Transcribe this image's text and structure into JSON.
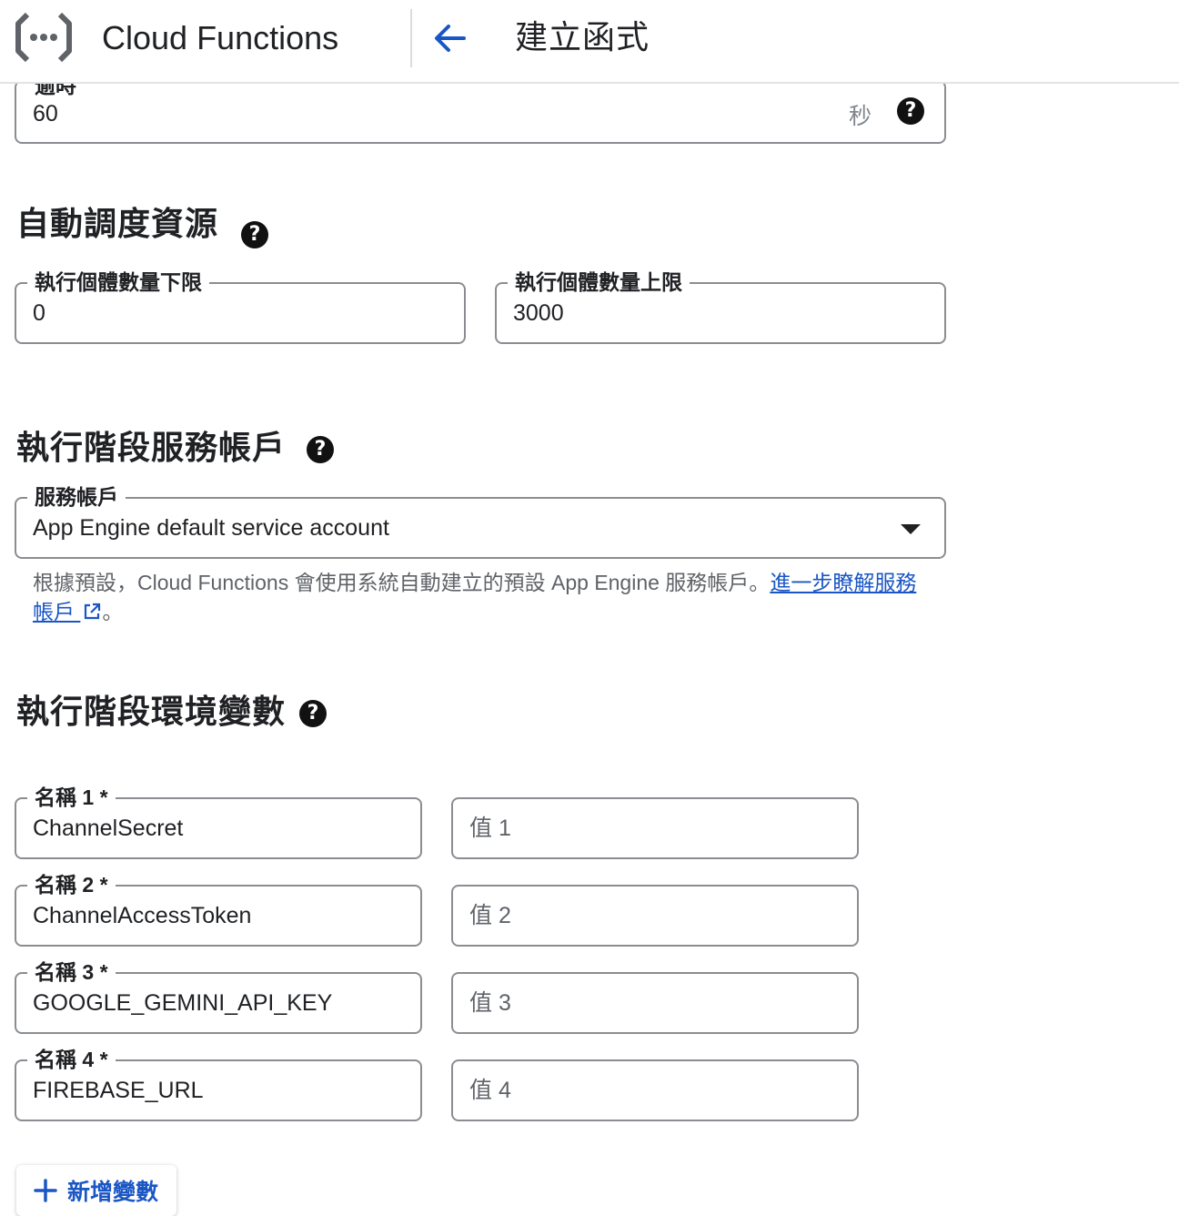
{
  "header": {
    "product_name": "Cloud Functions",
    "page_title": "建立函式",
    "back_icon": "arrow-left-icon",
    "logo_icon": "cloud-functions-logo",
    "accent_color": "#1a56c4"
  },
  "timeout": {
    "label": "逾時",
    "value": "60",
    "unit": "秒"
  },
  "autoscaling": {
    "title": "自動調度資源",
    "min_label": "執行個體數量下限",
    "min_value": "0",
    "max_label": "執行個體數量上限",
    "max_value": "3000"
  },
  "service_account": {
    "title": "執行階段服務帳戶",
    "field_label": "服務帳戶",
    "selected": "App Engine default service account",
    "hint_text": "根據預設，Cloud Functions 會使用系統自動建立的預設 App Engine 服務帳戶。",
    "hint_link": "進一步瞭解服務帳戶",
    "hint_end": "。"
  },
  "env_vars": {
    "title": "執行階段環境變數",
    "rows": [
      {
        "name_label": "名稱 1 *",
        "name_value": "ChannelSecret",
        "value_placeholder": "值 1"
      },
      {
        "name_label": "名稱 2 *",
        "name_value": "ChannelAccessToken",
        "value_placeholder": "值 2"
      },
      {
        "name_label": "名稱 3 *",
        "name_value": "GOOGLE_GEMINI_API_KEY",
        "value_placeholder": "值 3"
      },
      {
        "name_label": "名稱 4 *",
        "name_value": "FIREBASE_URL",
        "value_placeholder": "值 4"
      }
    ],
    "add_button": "新增變數"
  }
}
